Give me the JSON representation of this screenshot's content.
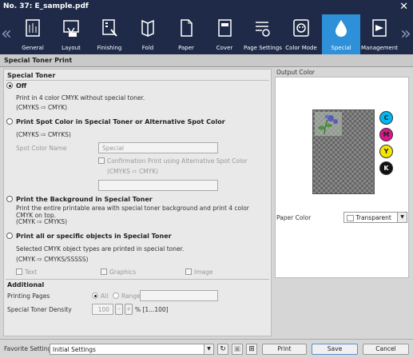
{
  "window": {
    "title": "No. 37: E_sample.pdf",
    "close_glyph": "✕"
  },
  "tabs": [
    {
      "label": "General",
      "icon": "general-icon"
    },
    {
      "label": "Layout",
      "icon": "layout-icon"
    },
    {
      "label": "Finishing",
      "icon": "finishing-icon"
    },
    {
      "label": "Fold",
      "icon": "fold-icon"
    },
    {
      "label": "Paper",
      "icon": "paper-icon"
    },
    {
      "label": "Cover",
      "icon": "cover-icon"
    },
    {
      "label": "Page Settings",
      "icon": "page-settings-icon"
    },
    {
      "label": "Color Mode",
      "icon": "color-mode-icon"
    },
    {
      "label": "Special",
      "icon": "special-drop-icon",
      "active": true
    },
    {
      "label": "Management",
      "icon": "management-icon"
    }
  ],
  "panel_title": "Special Toner Print",
  "special_toner": {
    "heading": "Special Toner",
    "off": {
      "label": "Off",
      "desc": "Print in 4 color CMYK without special toner.",
      "conv": "(CMYKS ⇨ CMYK)",
      "selected": true
    },
    "spot": {
      "label": "Print Spot Color in Special Toner or Alternative Spot Color",
      "conv": "(CMYKS ⇨ CMYKS)",
      "name_label": "Spot Color Name",
      "name_value": "Special",
      "confirm_label": "Confirmation Print using Alternative Spot Color",
      "confirm_conv": "(CMYKS ⇨ CMYK)"
    },
    "background": {
      "label": "Print the Background in Special Toner",
      "desc": "Print the entire printable area with special toner background and print 4 color CMYK on top.",
      "conv": "(CMYK ⇨ CMYKS)"
    },
    "objects": {
      "label": "Print all or specific objects in Special Toner",
      "desc": "Selected CMYK object types are printed in special toner.",
      "conv": "(CMYK ⇨ CMYKS/SSSSS)",
      "types": [
        "Text",
        "Graphics",
        "Image"
      ]
    }
  },
  "additional": {
    "heading": "Additional",
    "printing_pages_label": "Printing Pages",
    "all_label": "All",
    "range_label": "Range",
    "density_label": "Special Toner Density",
    "density_value": "100",
    "density_range": "% [1...100]",
    "minus": "–",
    "plus": "+"
  },
  "output": {
    "label": "Output Color",
    "swatches": [
      {
        "letter": "C",
        "color": "#00b8f0"
      },
      {
        "letter": "M",
        "color": "#e0148c"
      },
      {
        "letter": "Y",
        "color": "#f5e500"
      },
      {
        "letter": "K",
        "color": "#111111"
      }
    ],
    "paper_color_label": "Paper Color",
    "paper_color_value": "Transparent"
  },
  "bottom": {
    "favorite_label": "Favorite Setting",
    "favorite_value": "Initial Settings",
    "print": "Print",
    "save": "Save",
    "cancel": "Cancel"
  }
}
